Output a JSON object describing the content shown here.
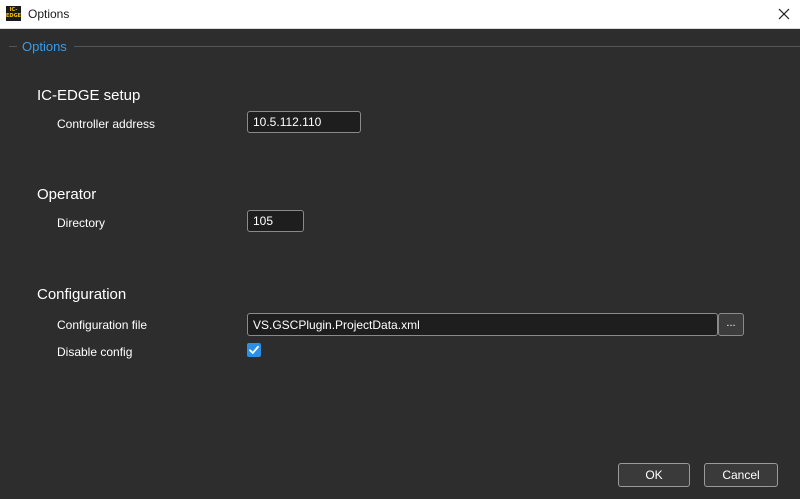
{
  "window": {
    "title": "Options",
    "logo_text": "IC-EDGE",
    "close_icon": "close-icon"
  },
  "group": {
    "title": "Options",
    "accent_color": "#3a9be8"
  },
  "sections": {
    "icedge": {
      "title": "IC-EDGE setup",
      "controller_label": "Controller address",
      "controller_value": "10.5.112.110"
    },
    "operator": {
      "title": "Operator",
      "directory_label": "Directory",
      "directory_value": "105"
    },
    "configuration": {
      "title": "Configuration",
      "file_label": "Configuration file",
      "file_value": "VS.GSCPlugin.ProjectData.xml",
      "browse_label": "...",
      "disable_label": "Disable config",
      "disable_checked": true
    }
  },
  "footer": {
    "ok_label": "OK",
    "cancel_label": "Cancel"
  }
}
